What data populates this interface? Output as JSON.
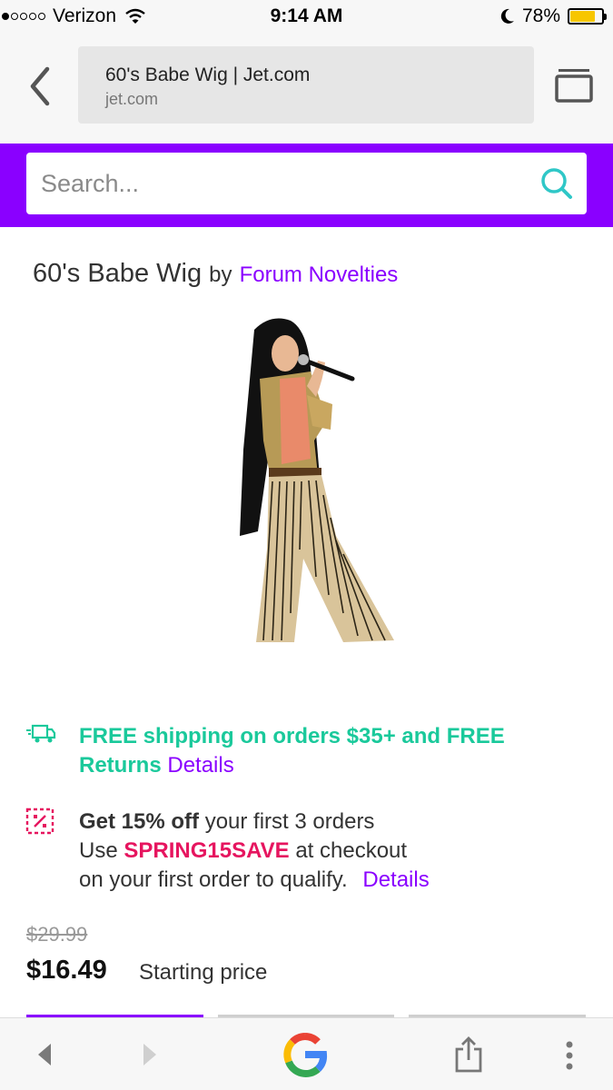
{
  "status_bar": {
    "carrier": "Verizon",
    "time": "9:14 AM",
    "battery": "78%",
    "battery_level": 0.78,
    "signal_icon": "signal-dots-icon",
    "wifi_icon": "wifi-icon",
    "moon_icon": "do-not-disturb-moon-icon"
  },
  "browser": {
    "page_title": "60's Babe Wig | Jet.com",
    "domain": "jet.com",
    "back_icon": "chevron-left-icon",
    "tabs_icon": "tabs-icon"
  },
  "search": {
    "placeholder": "Search...",
    "icon": "search-icon"
  },
  "product": {
    "title": "60's Babe Wig",
    "by": "by",
    "brand": "Forum Novelties",
    "image_icon": "product-image"
  },
  "promos": {
    "shipping": {
      "icon": "delivery-truck-icon",
      "text": "FREE shipping on orders $35+ and FREE Returns",
      "details": "Details"
    },
    "coupon": {
      "icon": "discount-tag-icon",
      "line1_bold": "Get 15% off",
      "line1_rest": "your first 3 orders",
      "line2_pre": "Use",
      "code": "SPRING15SAVE",
      "line2_post": "at checkout",
      "line3": "on your first order to qualify.",
      "details": "Details"
    }
  },
  "pricing": {
    "original": "$29.99",
    "current": "$16.49",
    "note": "Starting price"
  },
  "toolbar": {
    "back_icon": "back-arrow-icon",
    "forward_icon": "forward-arrow-icon",
    "google_icon": "google-logo-icon",
    "share_icon": "share-icon",
    "menu_icon": "more-vertical-icon"
  },
  "colors": {
    "brand_purple": "#8a00ff",
    "promo_green": "#1ac99b",
    "coupon_pink": "#e6155f",
    "search_teal": "#2fc7c7",
    "battery_yellow": "#f7c600"
  }
}
